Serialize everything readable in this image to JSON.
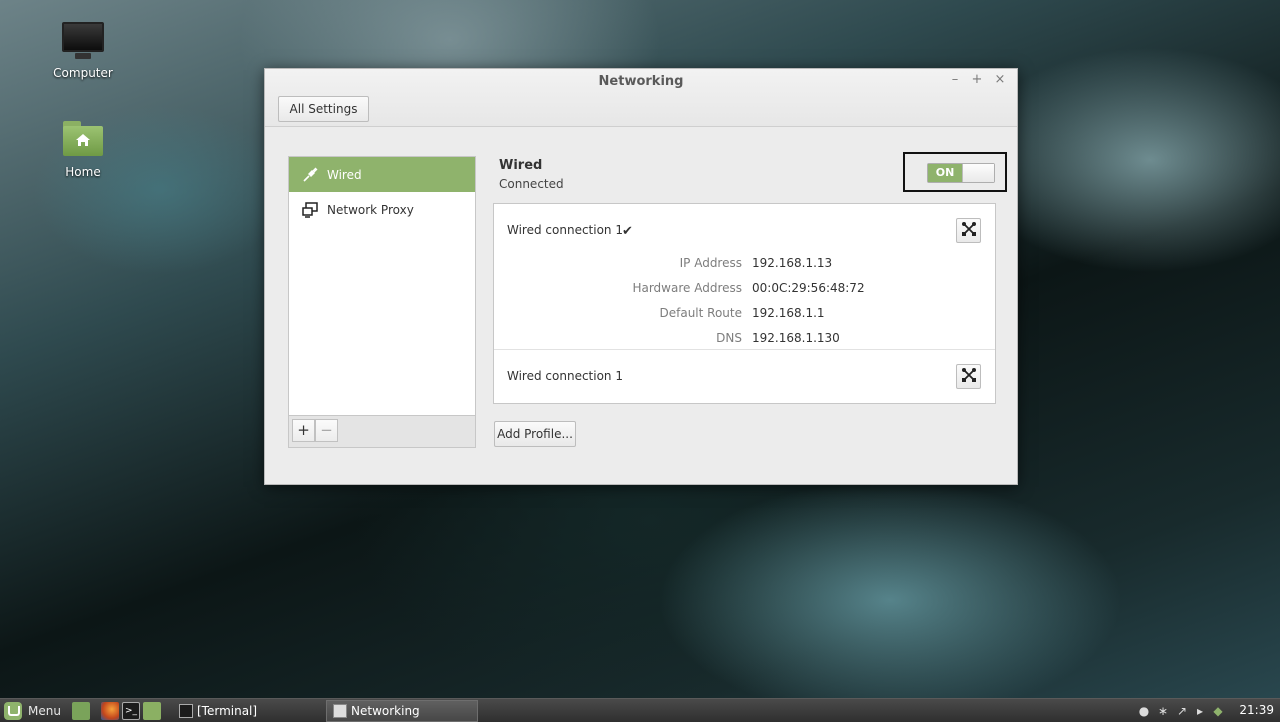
{
  "desktop": {
    "icons": [
      {
        "label": "Computer",
        "icon": "computer-icon"
      },
      {
        "label": "Home",
        "icon": "home-folder-icon"
      }
    ]
  },
  "window": {
    "title": "Networking",
    "controls": {
      "minimize": "–",
      "maximize": "+",
      "close": "×"
    },
    "all_settings_label": "All Settings"
  },
  "sidebar": {
    "items": [
      {
        "label": "Wired",
        "icon": "wired-plug-icon",
        "active": true
      },
      {
        "label": "Network Proxy",
        "icon": "network-proxy-icon",
        "active": false
      }
    ],
    "add_label": "+",
    "remove_label": "−"
  },
  "main": {
    "title": "Wired",
    "status": "Connected",
    "toggle_label": "ON",
    "connections": [
      {
        "name": "Wired connection 1",
        "active": true,
        "check": "✔",
        "details": [
          {
            "key": "IP Address",
            "value": "192.168.1.13"
          },
          {
            "key": "Hardware Address",
            "value": "00:0C:29:56:48:72"
          },
          {
            "key": "Default Route",
            "value": "192.168.1.1"
          },
          {
            "key": "DNS",
            "value": "192.168.1.130"
          }
        ]
      },
      {
        "name": "Wired connection 1",
        "active": false
      }
    ],
    "add_profile_label": "Add Profile..."
  },
  "taskbar": {
    "menu_label": "Menu",
    "tasks": [
      {
        "label": "[Terminal]",
        "icon": "terminal-icon",
        "active": false
      },
      {
        "label": "Networking",
        "icon": "networking-icon",
        "active": true
      }
    ],
    "clock": "21:39"
  },
  "colors": {
    "accent": "#8fb36c"
  }
}
